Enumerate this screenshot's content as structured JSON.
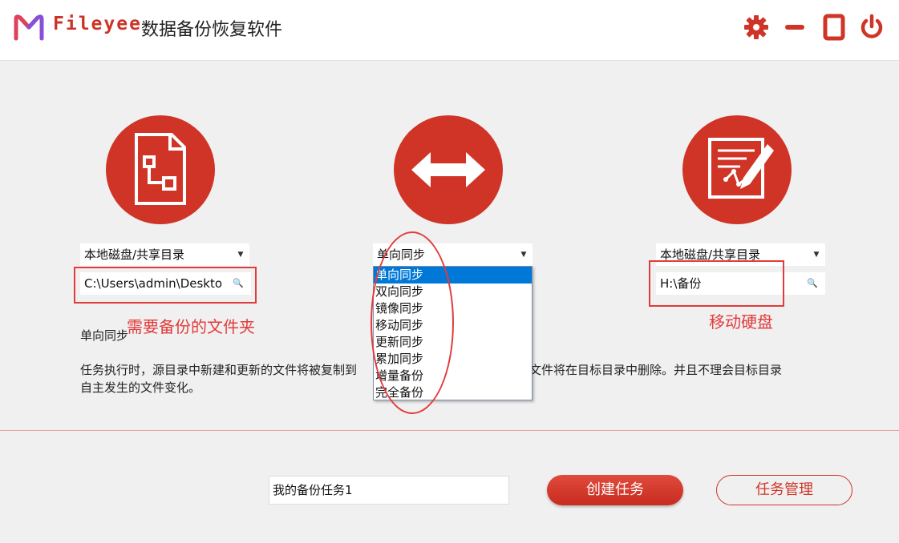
{
  "header": {
    "brand": "Fileyee",
    "title": "数据备份恢复软件"
  },
  "source": {
    "type_selected": "本地磁盘/共享目录",
    "path_value": "C:\\Users\\admin\\Deskto",
    "annotation": "需要备份的文件夹"
  },
  "mode": {
    "selected": "单向同步",
    "options": [
      "单向同步",
      "双向同步",
      "镜像同步",
      "移动同步",
      "更新同步",
      "累加同步",
      "增量备份",
      "完全备份"
    ]
  },
  "target": {
    "type_selected": "本地磁盘/共享目录",
    "path_value": "H:\\备份",
    "annotation": "移动硬盘"
  },
  "description": {
    "title": "单向同步",
    "body_part1": "任务执行时，源目录中新建和更新的文件将被复制到",
    "body_part2": "的文件将在目标目录中删除。并且不理会目标目录",
    "body_line2": "自主发生的文件变化。"
  },
  "footer": {
    "task_name": "我的备份任务1",
    "create_label": "创建任务",
    "manage_label": "任务管理"
  },
  "colors": {
    "brand_red": "#d03427",
    "annotation_red": "#e23b3b",
    "select_blue": "#0078d7"
  },
  "icons": {
    "settings": "gear-icon",
    "minimize": "minimize-icon",
    "maximize": "maximize-icon",
    "close": "power-icon",
    "source": "file-document-icon",
    "mode": "double-arrow-icon",
    "target": "edit-document-icon"
  }
}
